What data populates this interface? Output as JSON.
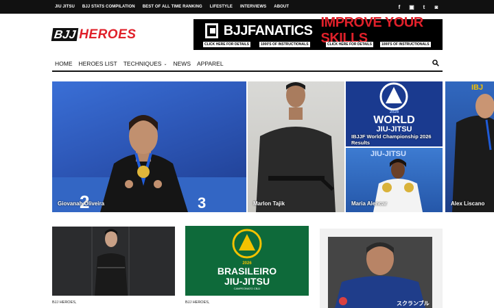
{
  "topnav": {
    "items": [
      "JIU JITSU",
      "BJJ STATS COMPILATION",
      "BEST OF ALL TIME RANKING",
      "LIFESTYLE",
      "INTERVIEWS",
      "ABOUT"
    ]
  },
  "social": {
    "icons": [
      "facebook-icon",
      "instagram-icon",
      "twitter-icon",
      "instagram-icon"
    ],
    "glyphs": [
      "f",
      "▣",
      "t",
      "◙"
    ]
  },
  "logo": {
    "part1": "BJJ",
    "part2": "HEROES"
  },
  "banner": {
    "brand": "BJJFANATICS",
    "slogan": "IMPROVE YOUR SKILLS",
    "small": [
      "CLICK HERE FOR DETAILS",
      "1000'S OF INSTRUCTIONALS",
      "CLICK HERE FOR DETAILS",
      "1000'S OF INSTRUCTIONALS"
    ]
  },
  "mainnav": {
    "items": [
      "HOME",
      "HEROES LIST",
      "TECHNIQUES",
      "NEWS",
      "APPAREL"
    ]
  },
  "tiles": {
    "t1": "Giovanah Oliveira",
    "t2": "Marlon Tajik",
    "t3": "IBJJF World Championship 2026 Results",
    "t3_year": "2026",
    "t3_line1": "WORLD",
    "t3_line2": "JIU-JITSU",
    "t4": "Maria Alencar",
    "t5": "Alex Liscano"
  },
  "cards": {
    "c2_year": "2026",
    "c2_line1": "BRASILEIRO",
    "c2_line2": "JIU-JITSU",
    "c2_sub": "CAMPEONATO CBJJ",
    "meta1": "BJJ HEROES,",
    "meta2": "BJJ HEROES,"
  },
  "colors": {
    "accent": "#e0202a",
    "dark": "#111111",
    "green": "#0e6a3a",
    "blue": "#1a3a8f"
  }
}
